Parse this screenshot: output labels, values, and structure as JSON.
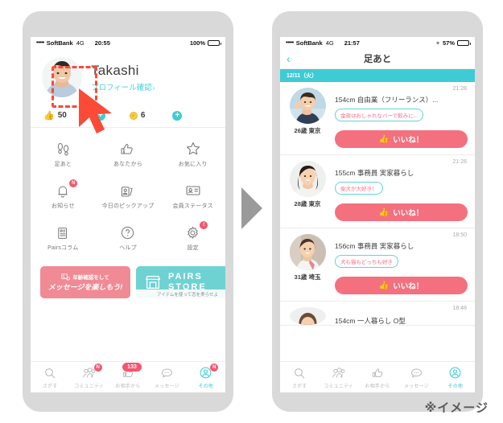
{
  "colors": {
    "teal": "#3ecbd4",
    "pink": "#f4707e",
    "badge_red": "#f4566e",
    "frame_gray": "#d9d9d9",
    "arrow_gray": "#9a9a9a"
  },
  "left_phone": {
    "status_bar": {
      "signal_dots": "•••••",
      "carrier": "SoftBank",
      "network": "4G",
      "time": "20:55",
      "battery_percent": "100%"
    },
    "profile": {
      "name": "Takashi",
      "link_label": "プロフィール確認",
      "link_chevron": "›",
      "avatar_icon": "user-photo"
    },
    "counters": [
      {
        "icon": "thumbs-up-icon",
        "value": "50",
        "plus_label": "+"
      },
      {
        "icon": "coin-icon",
        "value": "6",
        "plus_label": "+"
      }
    ],
    "menu_grid": [
      {
        "label": "足あと",
        "icon": "footprints-icon",
        "badge": ""
      },
      {
        "label": "あなたから",
        "icon": "thumbs-up-outline-icon",
        "badge": ""
      },
      {
        "label": "お気に入り",
        "icon": "star-outline-icon",
        "badge": ""
      },
      {
        "label": "お知らせ",
        "icon": "bell-icon",
        "badge": "N"
      },
      {
        "label": "今日のピックアップ",
        "icon": "cards-icon",
        "badge": ""
      },
      {
        "label": "会員ステータス",
        "icon": "id-card-icon",
        "badge": ""
      },
      {
        "label": "Pairsコラム",
        "icon": "newspaper-icon",
        "badge": ""
      },
      {
        "label": "ヘルプ",
        "icon": "question-circle-icon",
        "badge": ""
      },
      {
        "label": "設定",
        "icon": "gear-icon",
        "badge": "!"
      }
    ],
    "promos": [
      {
        "line1": "年齢確認をして",
        "line2": "メッセージを楽しもう!",
        "icon": "id-verify-icon"
      },
      {
        "line1": "PAIRS",
        "line2": "STORE",
        "sub": "アイテムを使って恋を実らせよ",
        "icon": "shop-icon"
      }
    ],
    "tabbar": [
      {
        "label": "さがす",
        "icon": "search-icon",
        "badge": "",
        "active": false
      },
      {
        "label": "コミュニティ",
        "icon": "people-icon",
        "badge": "N",
        "active": false
      },
      {
        "label": "お相手から",
        "icon": "thumbs-up-icon",
        "badge": "133",
        "active": false
      },
      {
        "label": "メッセージ",
        "icon": "chat-bubble-icon",
        "badge": "",
        "active": false
      },
      {
        "label": "その他",
        "icon": "person-circle-icon",
        "badge": "N",
        "active": true
      }
    ]
  },
  "right_phone": {
    "status_bar": {
      "signal_dots": "•••••",
      "carrier": "SoftBank",
      "network": "4G",
      "time": "21:57",
      "bluetooth_icon": "✶",
      "battery_percent": "57%"
    },
    "navbar": {
      "back_icon": "‹",
      "title": "足あと"
    },
    "date_label": "12/11（火）",
    "rows": [
      {
        "time": "21:28",
        "desc": "154cm 自由業（フリーランス）...",
        "tag": "金夜はおしゃれなバーで飲みに...",
        "caption": "26歳 東京",
        "button_label": "いいね！"
      },
      {
        "time": "21:26",
        "desc": "155cm 事務員 実家暮らし",
        "tag": "柴犬が大好き！",
        "caption": "28歳 東京",
        "button_label": "いいね！"
      },
      {
        "time": "18:50",
        "desc": "156cm 事務員 実家暮らし",
        "tag": "犬も猫もどっちも好き",
        "caption": "31歳 埼玉",
        "button_label": "いいね！"
      },
      {
        "time": "18:48",
        "desc": "154cm 一人暮らし O型",
        "tag": "",
        "caption": "",
        "button_label": ""
      }
    ],
    "tabbar": [
      {
        "label": "さがす",
        "icon": "search-icon",
        "active": false
      },
      {
        "label": "コミュニティ",
        "icon": "people-icon",
        "active": false
      },
      {
        "label": "お相手から",
        "icon": "thumbs-up-icon",
        "active": false
      },
      {
        "label": "メッセージ",
        "icon": "chat-bubble-icon",
        "active": false
      },
      {
        "label": "その他",
        "icon": "person-circle-icon",
        "active": true
      }
    ]
  },
  "annotation": {
    "image_note": "※イメージ",
    "highlight_target": "足あと",
    "cursor_icon": "arrow-cursor"
  }
}
